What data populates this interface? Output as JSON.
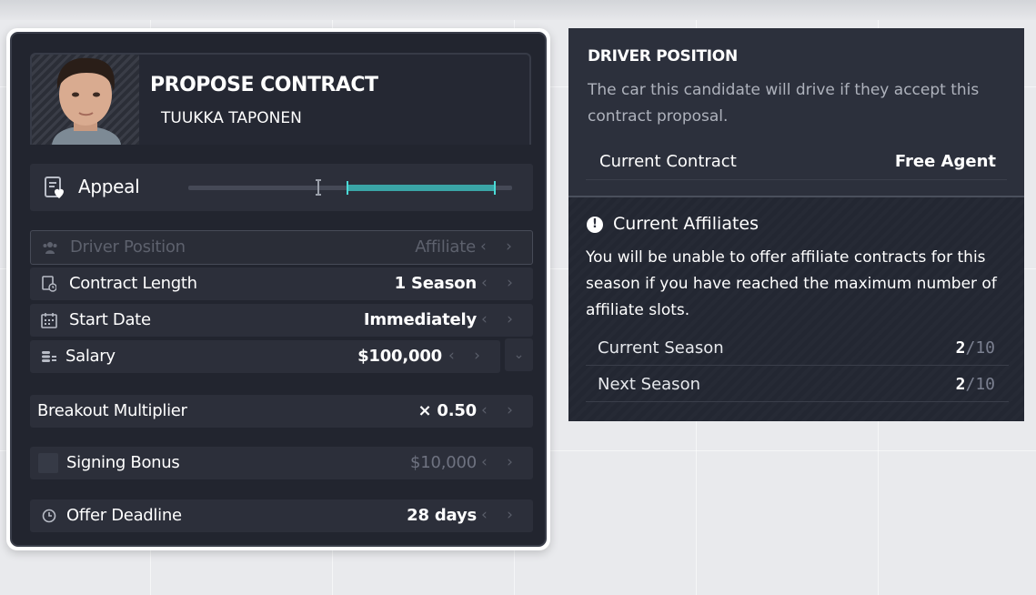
{
  "contract": {
    "title": "PROPOSE CONTRACT",
    "driver_name": "TUUKKA TAPONEN",
    "appeal_label": "Appeal",
    "appeal_level": 0.4,
    "appeal_range": [
      0.49,
      0.95
    ],
    "fields": {
      "driver_position": {
        "label": "Driver Position",
        "value": "Affiliate",
        "arrows": "‹ ›"
      },
      "contract_length": {
        "label": "Contract Length",
        "value": "1 Season",
        "arrows": "‹ ›"
      },
      "start_date": {
        "label": "Start Date",
        "value": "Immediately",
        "arrows": "‹ ›"
      },
      "salary": {
        "label": "Salary",
        "value": "$100,000",
        "arrows": "‹ ›",
        "dropdown": "⌄"
      },
      "breakout_multiplier": {
        "label": "Breakout Multiplier",
        "value": "× 0.50",
        "arrows": "‹ ›"
      },
      "signing_bonus": {
        "label": "Signing Bonus",
        "value": "$10,000",
        "arrows": "‹ ›"
      },
      "offer_deadline": {
        "label": "Offer Deadline",
        "value": "28 days",
        "arrows": "‹ ›"
      }
    }
  },
  "info": {
    "heading": "DRIVER POSITION",
    "description": "The car this candidate will drive if they accept this contract proposal.",
    "current_contract": {
      "label": "Current Contract",
      "value": "Free Agent"
    },
    "affiliates_heading": "Current Affiliates",
    "affiliates_icon": "!",
    "affiliates_desc": "You will be unable to offer affiliate contracts for this season if you have reached the maximum number of affiliate slots.",
    "seasons": [
      {
        "label": "Current Season",
        "count": "2",
        "max": "/10"
      },
      {
        "label": "Next Season",
        "count": "2",
        "max": "/10"
      }
    ]
  },
  "colors": {
    "panel_bg": "#22252f",
    "row_bg": "#2c2f3a",
    "accent_teal": "#3aa5a6"
  }
}
